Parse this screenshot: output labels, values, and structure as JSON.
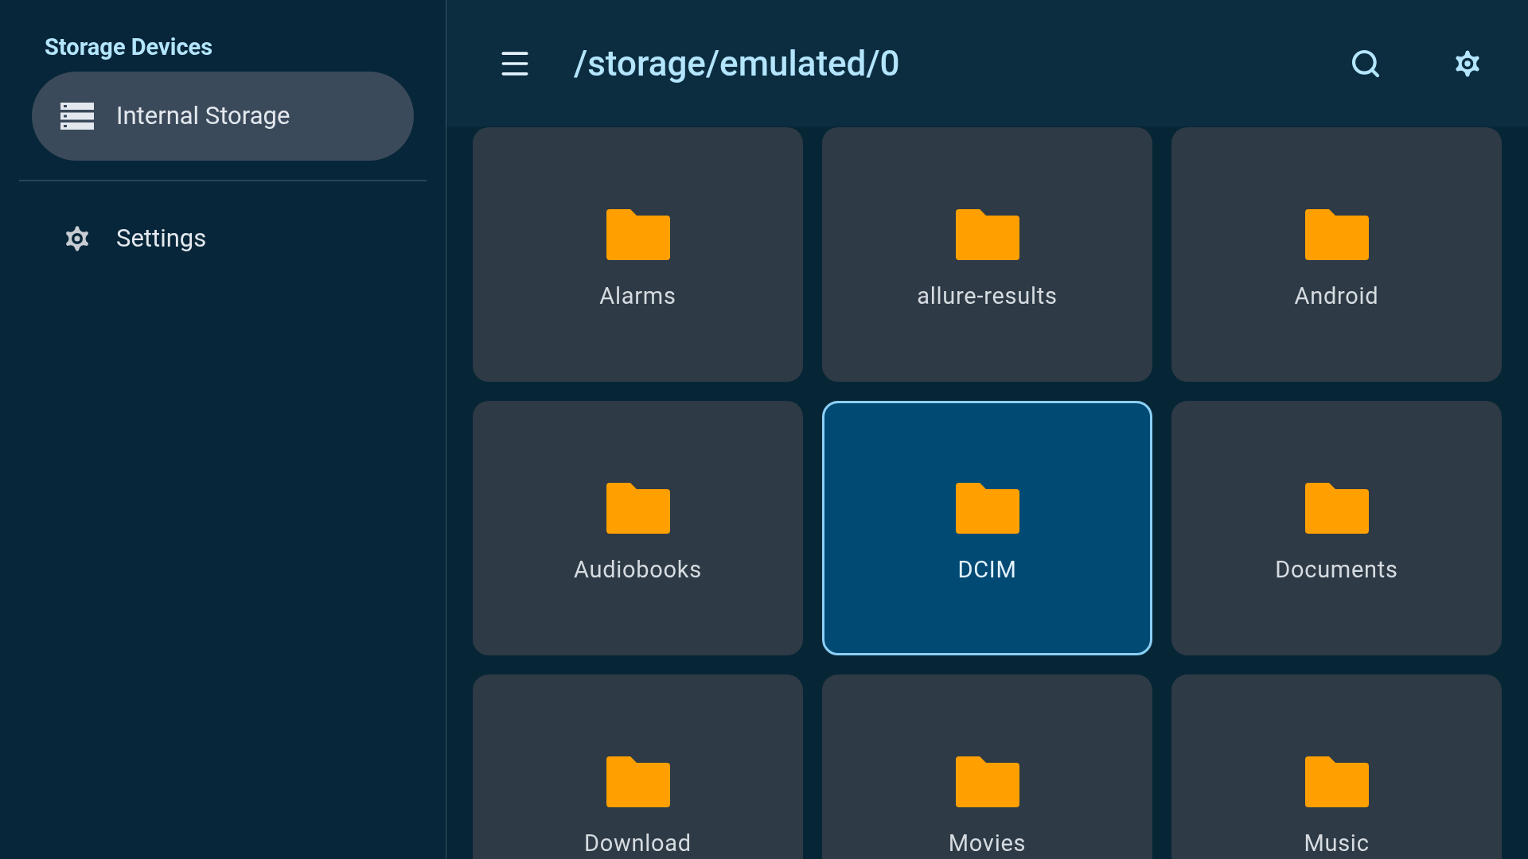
{
  "sidebar": {
    "title": "Storage Devices",
    "items": [
      {
        "kind": "storage",
        "label": "Internal Storage",
        "selected": true
      },
      {
        "kind": "settings",
        "label": "Settings",
        "selected": false
      }
    ]
  },
  "header": {
    "path": "/storage/emulated/0"
  },
  "folders": [
    {
      "name": "Alarms",
      "selected": false
    },
    {
      "name": "allure-results",
      "selected": false
    },
    {
      "name": "Android",
      "selected": false
    },
    {
      "name": "Audiobooks",
      "selected": false
    },
    {
      "name": "DCIM",
      "selected": true
    },
    {
      "name": "Documents",
      "selected": false
    },
    {
      "name": "Download",
      "selected": false
    },
    {
      "name": "Movies",
      "selected": false
    },
    {
      "name": "Music",
      "selected": false
    }
  ]
}
